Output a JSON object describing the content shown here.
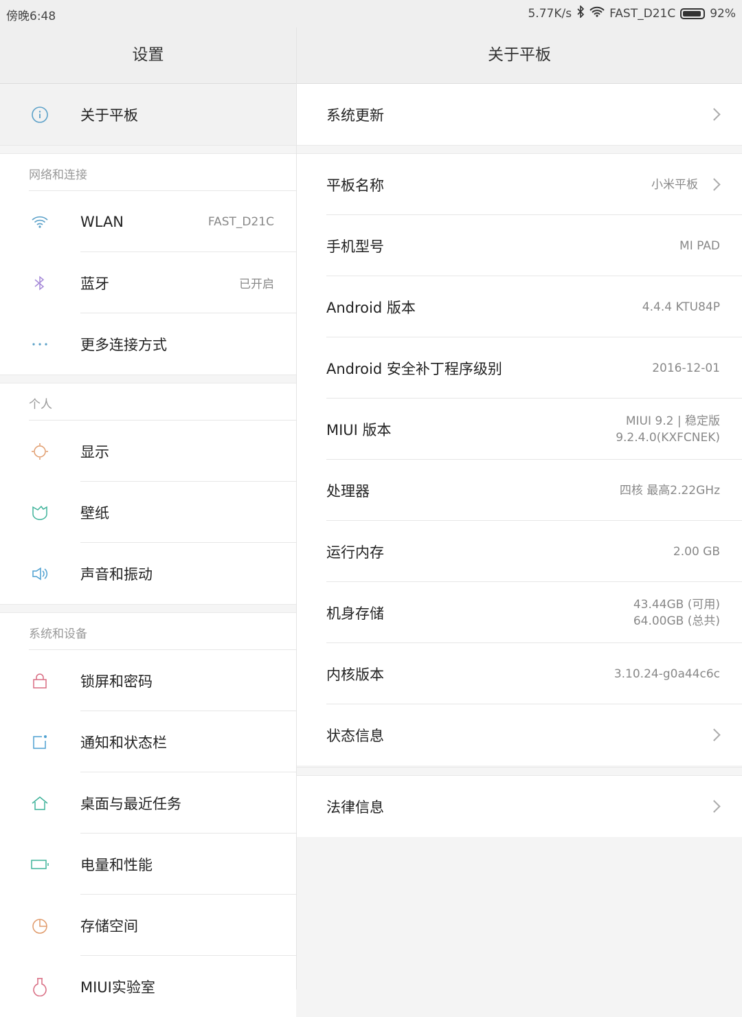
{
  "status_bar": {
    "time": "傍晚6:48",
    "speed": "5.77K/s",
    "network": "FAST_D21C",
    "battery": "92%",
    "battery_level": 0.92
  },
  "left": {
    "title": "设置",
    "about": "关于平板",
    "sections": [
      {
        "header": "网络和连接",
        "items": [
          {
            "label": "WLAN",
            "value": "FAST_D21C",
            "icon": "wifi-icon"
          },
          {
            "label": "蓝牙",
            "value": "已开启",
            "icon": "bluetooth-icon"
          },
          {
            "label": "更多连接方式",
            "icon": "more-icon"
          }
        ]
      },
      {
        "header": "个人",
        "items": [
          {
            "label": "显示",
            "icon": "display-icon"
          },
          {
            "label": "壁纸",
            "icon": "wallpaper-icon"
          },
          {
            "label": "声音和振动",
            "icon": "sound-icon"
          }
        ]
      },
      {
        "header": "系统和设备",
        "items": [
          {
            "label": "锁屏和密码",
            "icon": "lock-icon"
          },
          {
            "label": "通知和状态栏",
            "icon": "notification-icon"
          },
          {
            "label": "桌面与最近任务",
            "icon": "home-icon"
          },
          {
            "label": "电量和性能",
            "icon": "battery-icon"
          },
          {
            "label": "存储空间",
            "icon": "storage-icon"
          },
          {
            "label": "MIUI实验室",
            "icon": "lab-icon"
          }
        ]
      }
    ]
  },
  "right": {
    "title": "关于平板",
    "system_update": "系统更新",
    "items": [
      {
        "label": "平板名称",
        "value": "小米平板",
        "chevron": true
      },
      {
        "label": "手机型号",
        "value": "MI PAD"
      },
      {
        "label": "Android 版本",
        "value": "4.4.4 KTU84P"
      },
      {
        "label": "Android 安全补丁程序级别",
        "value": "2016-12-01"
      },
      {
        "label": "MIUI 版本",
        "value": "MIUI 9.2 | 稳定版",
        "value2": "9.2.4.0(KXFCNEK)"
      },
      {
        "label": "处理器",
        "value": "四核 最高2.22GHz"
      },
      {
        "label": "运行内存",
        "value": "2.00 GB"
      },
      {
        "label": "机身存储",
        "value": "43.44GB (可用)",
        "value2": "64.00GB (总共)"
      },
      {
        "label": "内核版本",
        "value": "3.10.24-g0a44c6c"
      },
      {
        "label": "状态信息",
        "chevron": true
      }
    ],
    "legal": "法律信息"
  }
}
